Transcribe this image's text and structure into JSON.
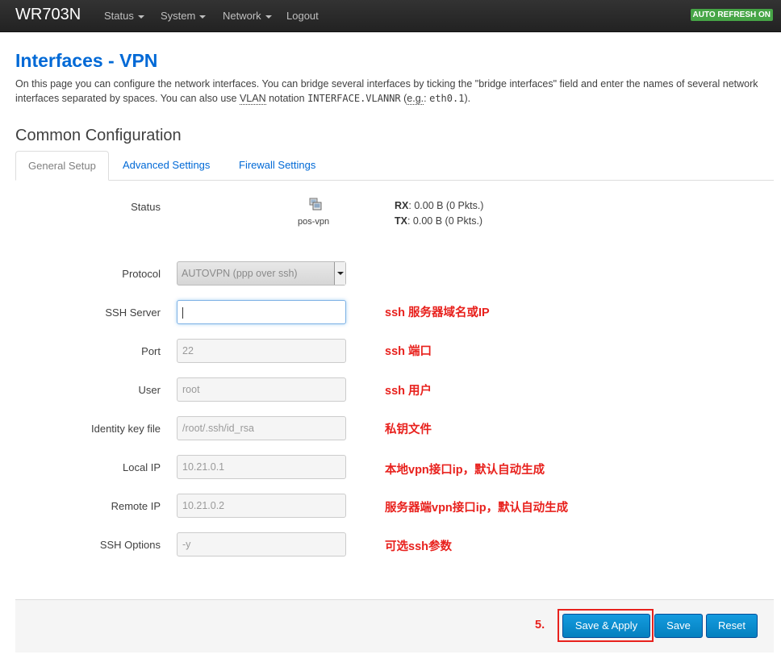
{
  "navbar": {
    "brand": "WR703N",
    "menus": [
      "Status",
      "System",
      "Network",
      "Logout"
    ],
    "auto_refresh": "AUTO REFRESH ON"
  },
  "page": {
    "title": "Interfaces - VPN",
    "desc_part1": "On this page you can configure the network interfaces. You can bridge several interfaces by ticking the \"bridge interfaces\" field and enter the names of several network interfaces separated by spaces. You can also use ",
    "desc_vlan": "VLAN",
    "desc_part2": " notation ",
    "desc_code": "INTERFACE.VLANNR",
    "desc_part3": " (",
    "desc_eg": "e.g.",
    "desc_part4": ": ",
    "desc_example": "eth0.1",
    "desc_part5": ").",
    "section": "Common Configuration"
  },
  "tabs": [
    "General Setup",
    "Advanced Settings",
    "Firewall Settings"
  ],
  "status": {
    "label": "Status",
    "icon": "network-interface-icon",
    "iface": "pos-vpn",
    "rx_label": "RX",
    "rx_value": ": 0.00 B (0 Pkts.)",
    "tx_label": "TX",
    "tx_value": ": 0.00 B (0 Pkts.)"
  },
  "form": {
    "protocol_label": "Protocol",
    "protocol_value": "AUTOVPN (ppp over ssh)",
    "ssh_server_label": "SSH Server",
    "ssh_server_value": "",
    "port_label": "Port",
    "port_value": "22",
    "user_label": "User",
    "user_value": "root",
    "identity_label": "Identity key file",
    "identity_value": "/root/.ssh/id_rsa",
    "local_ip_label": "Local IP",
    "local_ip_value": "10.21.0.1",
    "remote_ip_label": "Remote IP",
    "remote_ip_value": "10.21.0.2",
    "ssh_options_label": "SSH Options",
    "ssh_options_value": "-y"
  },
  "notes": {
    "ssh_server": "ssh 服务器域名或IP",
    "port": "ssh 端口",
    "user": "ssh 用户",
    "identity": "私钥文件",
    "local_ip": "本地vpn接口ip，默认自动生成",
    "remote_ip": "服务器端vpn接口ip，默认自动生成",
    "ssh_options": "可选ssh参数",
    "step": "5."
  },
  "buttons": {
    "save_apply": "Save & Apply",
    "save": "Save",
    "reset": "Reset"
  },
  "colors": {
    "brand_blue": "#0069d6",
    "annotation_red": "#e8211d",
    "refresh_green": "#46a546",
    "button_blue": "#0480be"
  }
}
